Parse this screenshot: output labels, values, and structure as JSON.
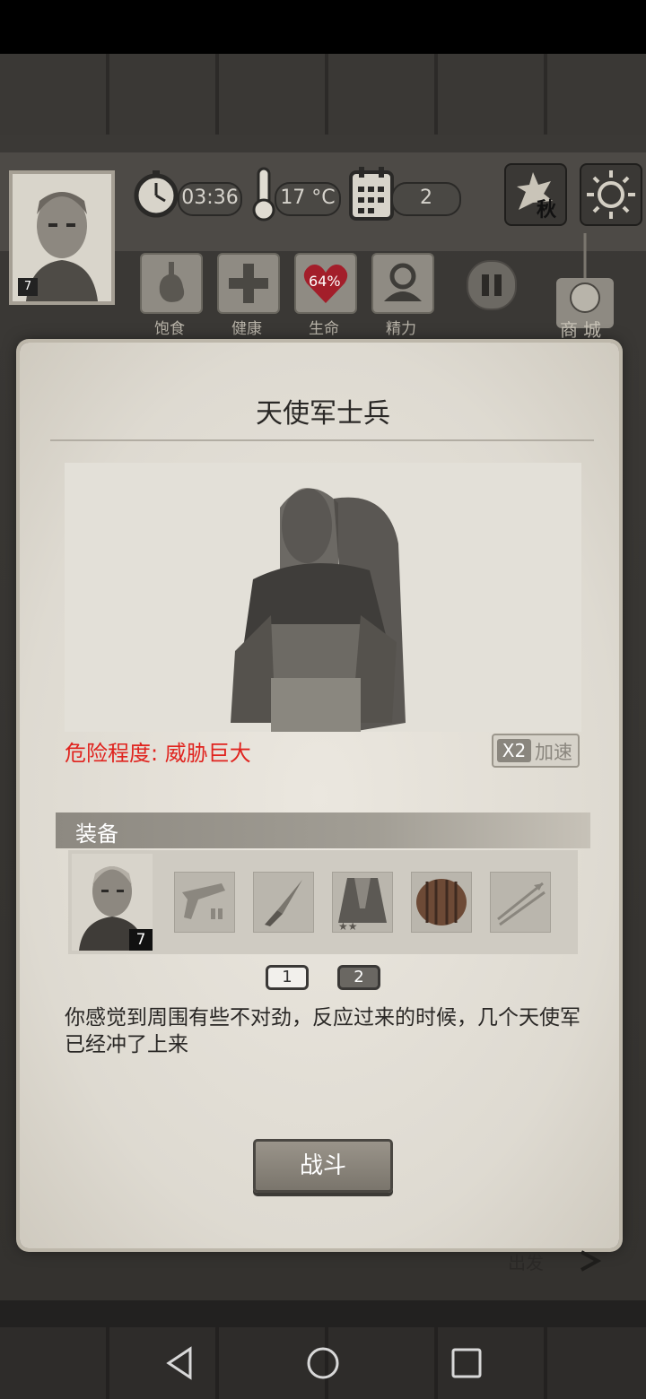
{
  "hud": {
    "time": "03:36",
    "temperature": "17 °C",
    "day": "2",
    "season": "秋",
    "portrait_level": "7",
    "stats": [
      {
        "label": "饱食"
      },
      {
        "label": "健康"
      },
      {
        "label": "生命",
        "value": "64%"
      },
      {
        "label": "精力"
      }
    ],
    "shop_label": "商城"
  },
  "dialog": {
    "title": "天使军士兵",
    "danger_text": "危险程度: 威胁巨大",
    "speed_prefix": "X2",
    "speed_label": "加速",
    "equipment_header": "装备",
    "equipment_level": "7",
    "equipment_slots": [
      "flintlock-pistol",
      "knife",
      "cloak",
      "wooden-shield",
      "arrows"
    ],
    "pages": [
      "1",
      "2"
    ],
    "description": "你感觉到周围有些不对劲，反应过来的时候，几个天使军已经冲了上来",
    "fight_label": "战斗"
  },
  "background_text": "出发",
  "colors": {
    "danger": "#e0231e",
    "parchment": "#e5e1d9"
  }
}
